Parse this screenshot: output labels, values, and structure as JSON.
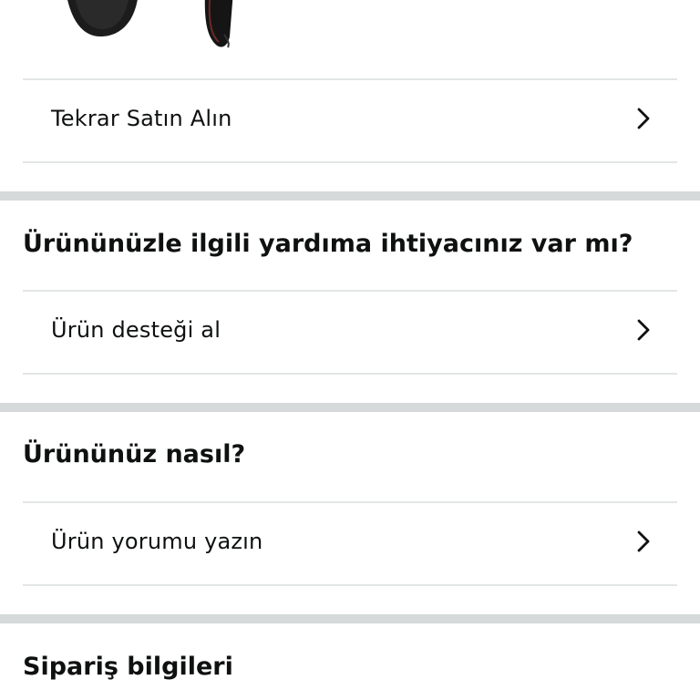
{
  "product": {
    "image_icon": "hair-dryer-image"
  },
  "reorder": {
    "label": "Tekrar Satın Alın",
    "chevron_icon": "chevron-right-icon"
  },
  "support_section": {
    "title": "Ürününüzle ilgili yardıma ihtiyacınız var mı?",
    "item_label": "Ürün desteği al",
    "chevron_icon": "chevron-right-icon"
  },
  "review_section": {
    "title": "Ürününüz nasıl?",
    "item_label": "Ürün yorumu yazın",
    "chevron_icon": "chevron-right-icon"
  },
  "order_info_section": {
    "title": "Sipariş bilgileri"
  }
}
